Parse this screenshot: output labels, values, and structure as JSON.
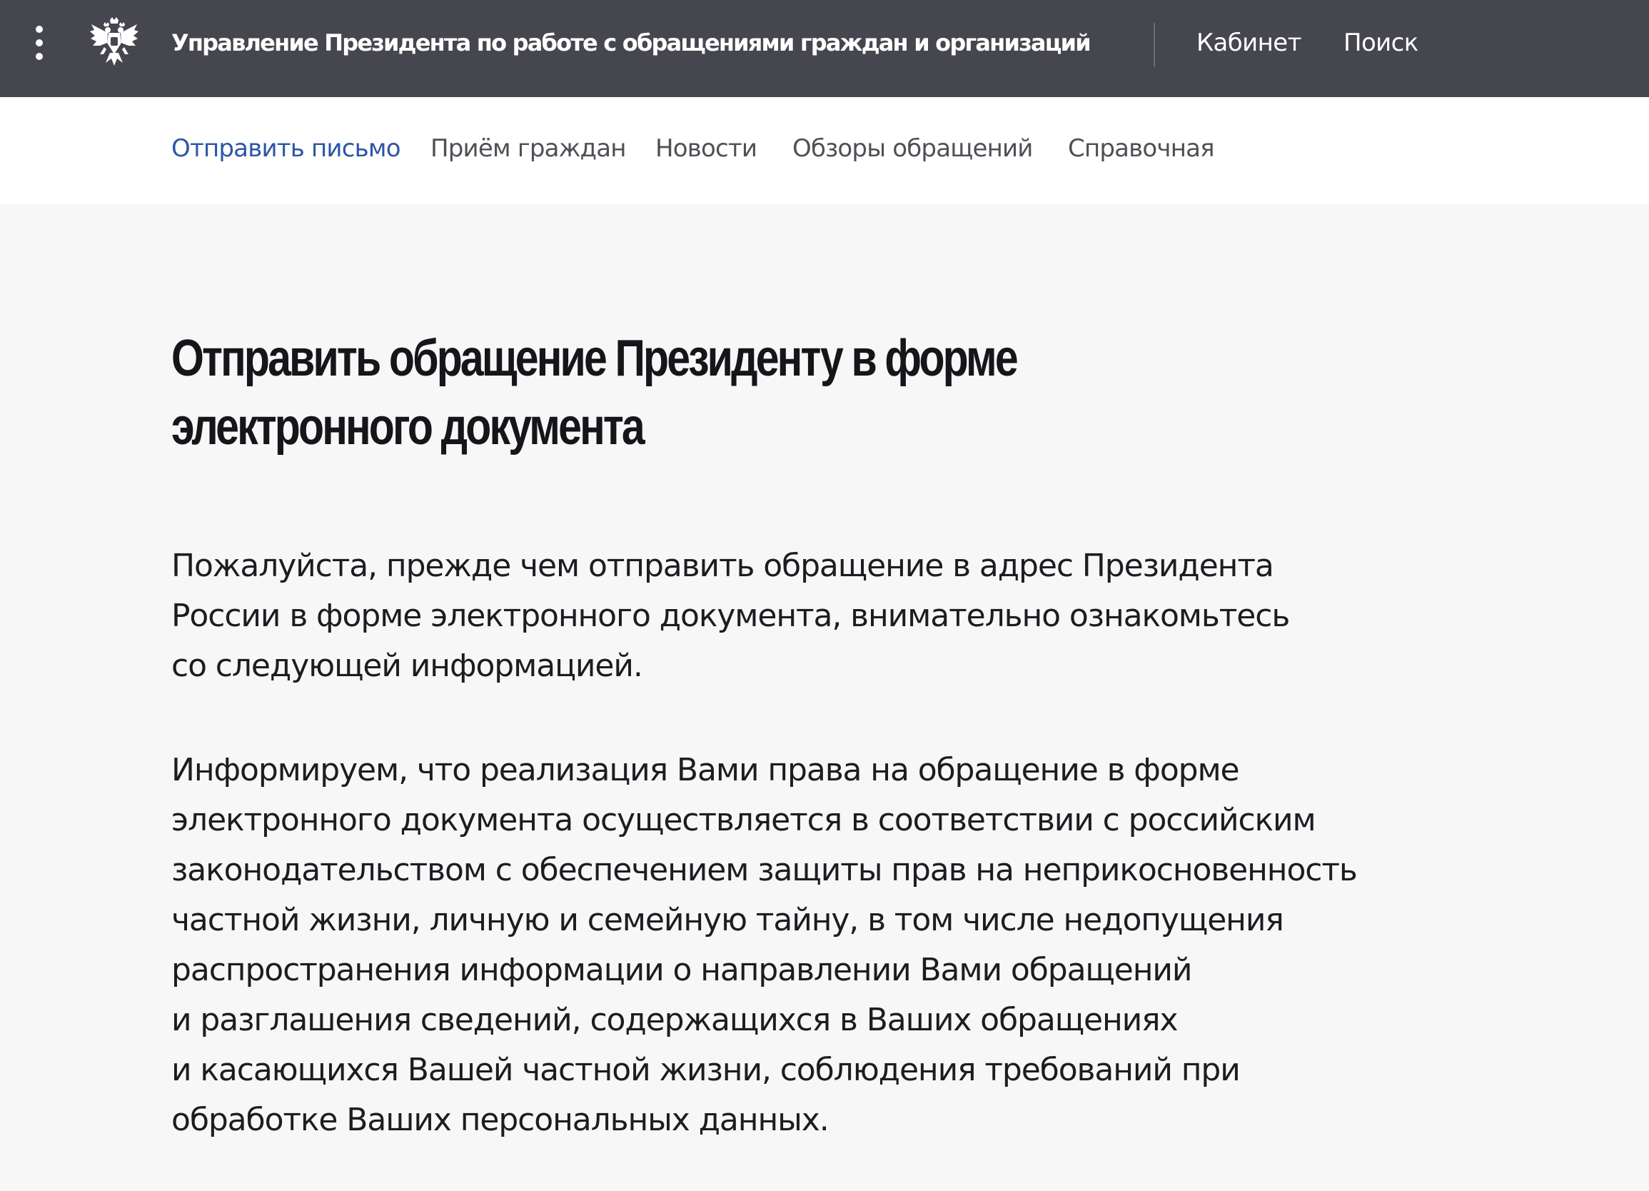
{
  "header": {
    "site_title": "Управление Президента по работе с обращениями граждан и организаций",
    "links": [
      "Кабинет",
      "Поиск"
    ],
    "background": "#45464e"
  },
  "subnav": {
    "items": [
      "Отправить письмо",
      "Приём граждан",
      "Новости",
      "Обзоры обращений",
      "Справочная"
    ],
    "active_index": 0,
    "active_color": "#2d55a8"
  },
  "main": {
    "title_lines": [
      "Отправить обращение Президенту в форме",
      "электронного документа"
    ],
    "paragraphs": [
      {
        "lines": [
          "Пожалуйста, прежде чем отправить обращение в адрес Президента",
          "России в форме электронного документа, внимательно ознакомьтесь",
          "со следующей информацией."
        ]
      },
      {
        "lines": [
          "Информируем, что реализация Вами права на обращение в форме",
          "электронного документа осуществляется в соответствии с российским",
          "законодательством с обеспечением защиты прав на неприкосновенность",
          "частной жизни, личную и семейную тайну, в том числе недопущения",
          "распространения информации о направлении Вами обращений",
          "и разглашения сведений, содержащихся в Ваших обращениях",
          "и касающихся Вашей частной жизни, соблюдения требований при",
          "обработке Ваших персональных данных."
        ]
      }
    ]
  },
  "icons": {
    "menu": "more-vertical-icon",
    "emblem": "double-headed-eagle-emblem-icon"
  }
}
